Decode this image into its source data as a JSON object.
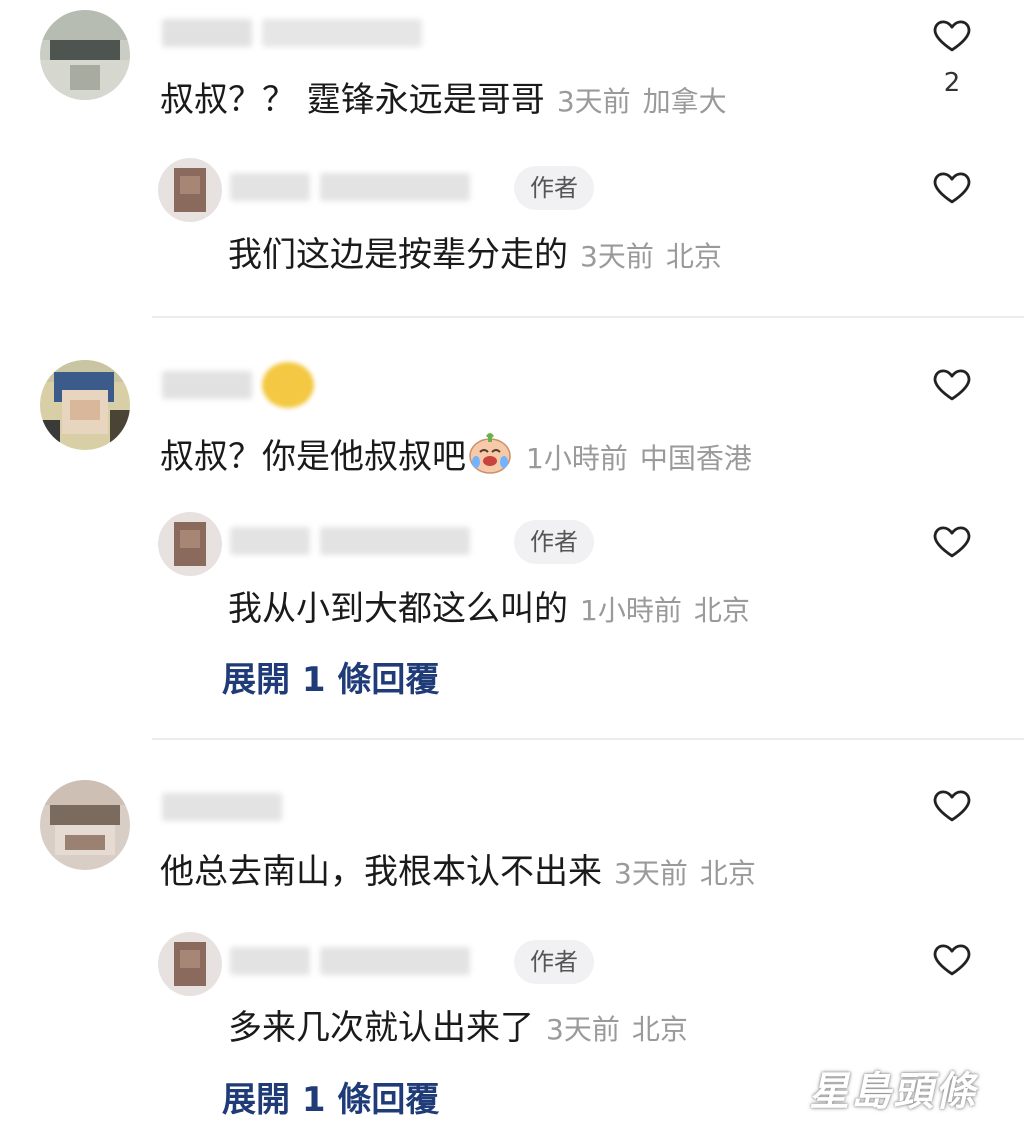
{
  "comments": [
    {
      "text": "叔叔？？ 霆锋永远是哥哥",
      "time": "3天前",
      "location": "加拿大",
      "like_count": "2",
      "reply": {
        "author_tag": "作者",
        "text": "我们这边是按辈分走的",
        "time": "3天前",
        "location": "北京"
      }
    },
    {
      "text": "叔叔？你是他叔叔吧",
      "time": "1小時前",
      "location": "中国香港",
      "reply": {
        "author_tag": "作者",
        "text": "我从小到大都这么叫的",
        "time": "1小時前",
        "location": "北京"
      },
      "expand_label": "展開 1 條回覆"
    },
    {
      "text": "他总去南山，我根本认不出来",
      "time": "3天前",
      "location": "北京",
      "reply": {
        "author_tag": "作者",
        "text": "多来几次就认出来了",
        "time": "3天前",
        "location": "北京"
      },
      "expand_label": "展開 1 條回覆"
    }
  ],
  "watermark": "星島頭條",
  "icons": {
    "like": "heart-outline-icon",
    "emoji": "crying-laughing-face-emoji"
  },
  "colors": {
    "expand_link": "#1f3b78",
    "meta": "#9a9a9a",
    "author_tag_bg": "#f1f1f3"
  }
}
